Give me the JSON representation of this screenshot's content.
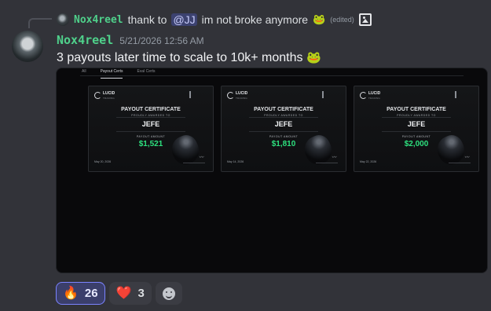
{
  "reply": {
    "username": "Nox4reel",
    "text_before_mention": "thank to",
    "mention": "@JJ",
    "text_after_mention": "im not broke anymore",
    "emoji": "🐸",
    "edited_label": "(edited)",
    "attachment_icon": "image-icon"
  },
  "message": {
    "username": "Nox4reel",
    "timestamp": "5/21/2026 12:56 AM",
    "text": "3 payouts later time to scale to 10k+ months",
    "emoji": "🐸"
  },
  "attachment": {
    "tabs": [
      {
        "label": "All"
      },
      {
        "label": "Payout Certs",
        "active": true
      },
      {
        "label": "Eval Certs"
      }
    ],
    "certificates": [
      {
        "brand": "LUCID",
        "brand_sub": "TRADING",
        "title": "PAYOUT CERTIFICATE",
        "subtitle": "PROUDLY AWARDED TO",
        "recipient": "JEFE",
        "amount_label": "PAYOUT AMOUNT",
        "amount": "$1,521",
        "date": "May 20, 2026"
      },
      {
        "brand": "LUCID",
        "brand_sub": "TRADING",
        "title": "PAYOUT CERTIFICATE",
        "subtitle": "PROUDLY AWARDED TO",
        "recipient": "JEFE",
        "amount_label": "PAYOUT AMOUNT",
        "amount": "$1,810",
        "date": "May 14, 2026"
      },
      {
        "brand": "LUCID",
        "brand_sub": "TRADING",
        "title": "PAYOUT CERTIFICATE",
        "subtitle": "PROUDLY AWARDED TO",
        "recipient": "JEFE",
        "amount_label": "PAYOUT AMOUNT",
        "amount": "$2,000",
        "date": "May 22, 2026"
      }
    ]
  },
  "reactions": [
    {
      "emoji": "🔥",
      "count": "26",
      "active": true
    },
    {
      "emoji": "❤️",
      "count": "3",
      "active": false
    }
  ],
  "add_reaction_icon": "smile-icon"
}
